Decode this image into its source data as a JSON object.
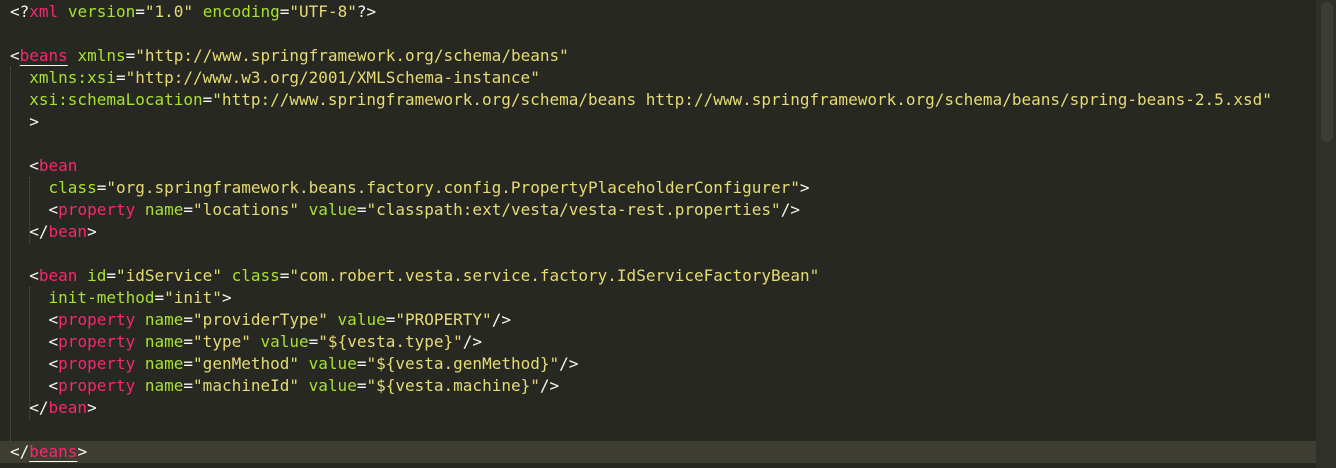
{
  "editor": {
    "language": "xml",
    "colors": {
      "background": "#272822",
      "current_line": "#3e3d32",
      "tag": "#f92672",
      "attribute": "#a6e22e",
      "string": "#e6db74",
      "text": "#f8f8f2"
    },
    "current_line_index": 20,
    "lines": [
      [
        [
          "punc",
          "<?"
        ],
        [
          "tag",
          "xml"
        ],
        [
          "text",
          " "
        ],
        [
          "attr",
          "version"
        ],
        [
          "punc",
          "="
        ],
        [
          "str",
          "\"1.0\""
        ],
        [
          "text",
          " "
        ],
        [
          "attr",
          "encoding"
        ],
        [
          "punc",
          "="
        ],
        [
          "str",
          "\"UTF-8\""
        ],
        [
          "punc",
          "?>"
        ]
      ],
      [],
      [
        [
          "punc",
          "<"
        ],
        [
          "tag-matched",
          "beans"
        ],
        [
          "text",
          " "
        ],
        [
          "attr",
          "xmlns"
        ],
        [
          "punc",
          "="
        ],
        [
          "str",
          "\"http://www.springframework.org/schema/beans\""
        ]
      ],
      [
        [
          "text",
          "  "
        ],
        [
          "attr",
          "xmlns:xsi"
        ],
        [
          "punc",
          "="
        ],
        [
          "str",
          "\"http://www.w3.org/2001/XMLSchema-instance\""
        ]
      ],
      [
        [
          "text",
          "  "
        ],
        [
          "attr",
          "xsi:schemaLocation"
        ],
        [
          "punc",
          "="
        ],
        [
          "str",
          "\"http://www.springframework.org/schema/beans http://www.springframework.org/schema/beans/spring-beans-2.5.xsd\""
        ]
      ],
      [
        [
          "text",
          "  "
        ],
        [
          "punc",
          ">"
        ]
      ],
      [],
      [
        [
          "text",
          "  "
        ],
        [
          "punc",
          "<"
        ],
        [
          "tag",
          "bean"
        ]
      ],
      [
        [
          "text",
          "    "
        ],
        [
          "attr",
          "class"
        ],
        [
          "punc",
          "="
        ],
        [
          "str",
          "\"org.springframework.beans.factory.config.PropertyPlaceholderConfigurer\""
        ],
        [
          "punc",
          ">"
        ]
      ],
      [
        [
          "text",
          "    "
        ],
        [
          "punc",
          "<"
        ],
        [
          "tag",
          "property"
        ],
        [
          "text",
          " "
        ],
        [
          "attr",
          "name"
        ],
        [
          "punc",
          "="
        ],
        [
          "str",
          "\"locations\""
        ],
        [
          "text",
          " "
        ],
        [
          "attr",
          "value"
        ],
        [
          "punc",
          "="
        ],
        [
          "str",
          "\"classpath:ext/vesta/vesta-rest.properties\""
        ],
        [
          "punc",
          "/>"
        ]
      ],
      [
        [
          "text",
          "  "
        ],
        [
          "punc",
          "</"
        ],
        [
          "tag",
          "bean"
        ],
        [
          "punc",
          ">"
        ]
      ],
      [],
      [
        [
          "text",
          "  "
        ],
        [
          "punc",
          "<"
        ],
        [
          "tag",
          "bean"
        ],
        [
          "text",
          " "
        ],
        [
          "attr",
          "id"
        ],
        [
          "punc",
          "="
        ],
        [
          "str",
          "\"idService\""
        ],
        [
          "text",
          " "
        ],
        [
          "attr",
          "class"
        ],
        [
          "punc",
          "="
        ],
        [
          "str",
          "\"com.robert.vesta.service.factory.IdServiceFactoryBean\""
        ]
      ],
      [
        [
          "text",
          "    "
        ],
        [
          "attr",
          "init-method"
        ],
        [
          "punc",
          "="
        ],
        [
          "str",
          "\"init\""
        ],
        [
          "punc",
          ">"
        ]
      ],
      [
        [
          "text",
          "    "
        ],
        [
          "punc",
          "<"
        ],
        [
          "tag",
          "property"
        ],
        [
          "text",
          " "
        ],
        [
          "attr",
          "name"
        ],
        [
          "punc",
          "="
        ],
        [
          "str",
          "\"providerType\""
        ],
        [
          "text",
          " "
        ],
        [
          "attr",
          "value"
        ],
        [
          "punc",
          "="
        ],
        [
          "str",
          "\"PROPERTY\""
        ],
        [
          "punc",
          "/>"
        ]
      ],
      [
        [
          "text",
          "    "
        ],
        [
          "punc",
          "<"
        ],
        [
          "tag",
          "property"
        ],
        [
          "text",
          " "
        ],
        [
          "attr",
          "name"
        ],
        [
          "punc",
          "="
        ],
        [
          "str",
          "\"type\""
        ],
        [
          "text",
          " "
        ],
        [
          "attr",
          "value"
        ],
        [
          "punc",
          "="
        ],
        [
          "str",
          "\"${vesta.type}\""
        ],
        [
          "punc",
          "/>"
        ]
      ],
      [
        [
          "text",
          "    "
        ],
        [
          "punc",
          "<"
        ],
        [
          "tag",
          "property"
        ],
        [
          "text",
          " "
        ],
        [
          "attr",
          "name"
        ],
        [
          "punc",
          "="
        ],
        [
          "str",
          "\"genMethod\""
        ],
        [
          "text",
          " "
        ],
        [
          "attr",
          "value"
        ],
        [
          "punc",
          "="
        ],
        [
          "str",
          "\"${vesta.genMethod}\""
        ],
        [
          "punc",
          "/>"
        ]
      ],
      [
        [
          "text",
          "    "
        ],
        [
          "punc",
          "<"
        ],
        [
          "tag",
          "property"
        ],
        [
          "text",
          " "
        ],
        [
          "attr",
          "name"
        ],
        [
          "punc",
          "="
        ],
        [
          "str",
          "\"machineId\""
        ],
        [
          "text",
          " "
        ],
        [
          "attr",
          "value"
        ],
        [
          "punc",
          "="
        ],
        [
          "str",
          "\"${vesta.machine}\""
        ],
        [
          "punc",
          "/>"
        ]
      ],
      [
        [
          "text",
          "  "
        ],
        [
          "punc",
          "</"
        ],
        [
          "tag",
          "bean"
        ],
        [
          "punc",
          ">"
        ]
      ],
      [],
      [
        [
          "punc",
          "</"
        ],
        [
          "tag-matched",
          "beans"
        ],
        [
          "punc",
          ">"
        ]
      ]
    ]
  }
}
